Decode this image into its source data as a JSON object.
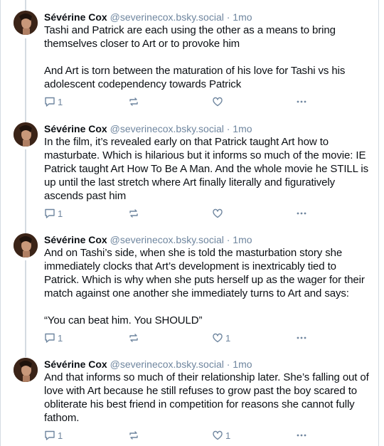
{
  "posts": [
    {
      "author": "Sévérine Cox",
      "handle": "@severinecox.bsky.social",
      "separator": "·",
      "time": "1mo",
      "text": "Tashi and Patrick are each using the other as a means to bring themselves closer to Art or to provoke him\n\nAnd Art is torn between the maturation of his love for Tashi vs his adolescent codependency towards Patrick",
      "reply_count": "1",
      "like_count": ""
    },
    {
      "author": "Sévérine Cox",
      "handle": "@severinecox.bsky.social",
      "separator": "·",
      "time": "1mo",
      "text": "In the film, it’s revealed early on that Patrick taught Art how to masturbate. Which is hilarious but it informs so much of the movie: IE Patrick taught Art How To Be A Man. And the whole movie he STILL is up until the last stretch where Art finally literally and figuratively ascends past him",
      "reply_count": "1",
      "like_count": ""
    },
    {
      "author": "Sévérine Cox",
      "handle": "@severinecox.bsky.social",
      "separator": "·",
      "time": "1mo",
      "text": "And on Tashi’s side, when she is told the masturbation story she immediately clocks that Art’s development is inextricably tied to Patrick. Which is why when she puts herself up as the wager for their match against one another she immediately turns to Art and says:\n\n“You can beat him. You SHOULD”",
      "reply_count": "1",
      "like_count": "1"
    },
    {
      "author": "Sévérine Cox",
      "handle": "@severinecox.bsky.social",
      "separator": "·",
      "time": "1mo",
      "text": "And that informs so much of their relationship later. She’s falling out of love with Art because he still refuses to grow past the boy scared to obliterate his best friend in competition for reasons she cannot fully fathom.",
      "reply_count": "1",
      "like_count": "1"
    }
  ],
  "icons": {
    "reply": "reply-bubble-icon",
    "repost": "repost-icon",
    "like": "heart-icon",
    "more": "more-options-icon"
  },
  "colors": {
    "text": "#0b0f14",
    "muted": "#6f869f",
    "thread_line": "#d4dbe2"
  }
}
